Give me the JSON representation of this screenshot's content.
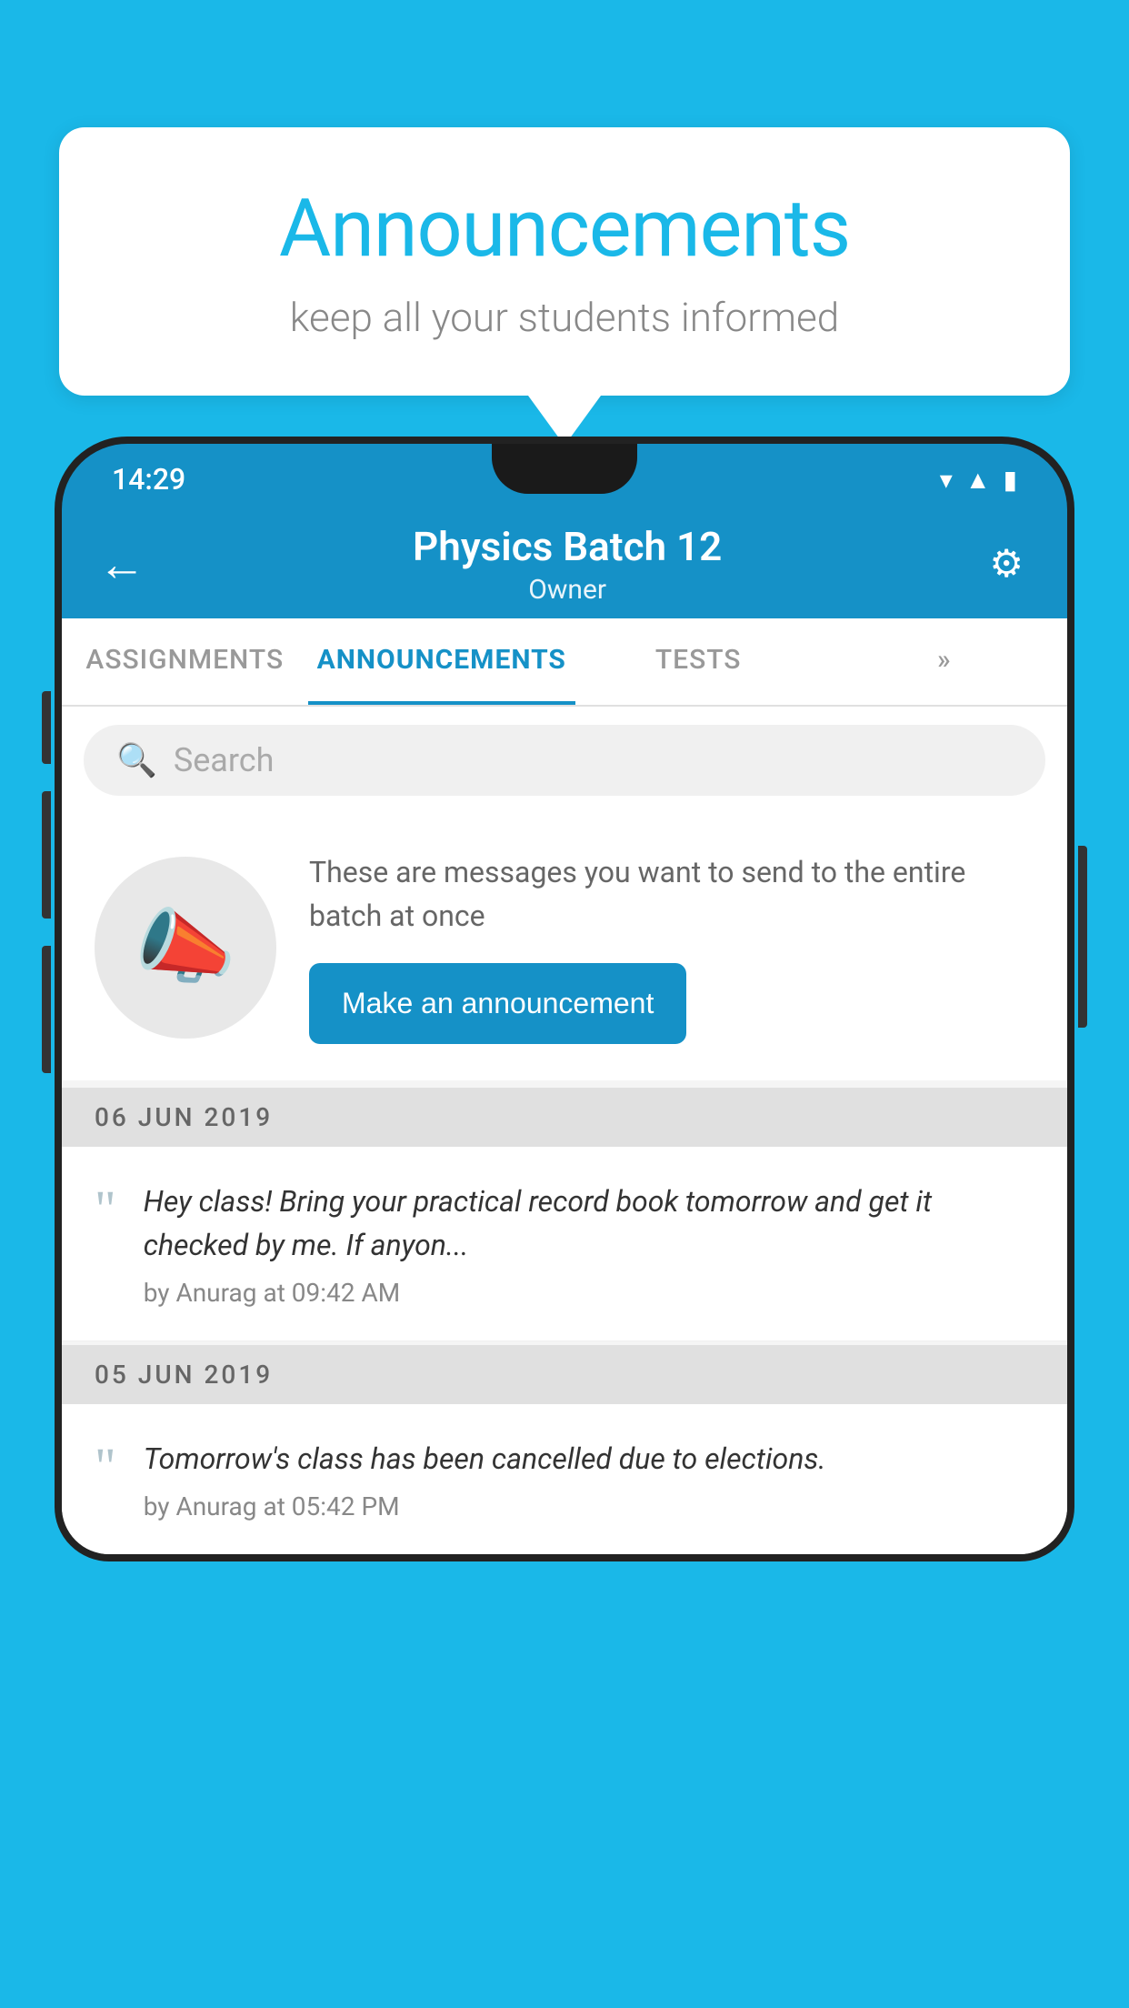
{
  "header": {
    "background_color": "#1ab8e8",
    "speech_bubble": {
      "title": "Announcements",
      "subtitle": "keep all your students informed"
    }
  },
  "phone": {
    "status_bar": {
      "time": "14:29",
      "wifi": "▾",
      "signal": "▲",
      "battery": "▮"
    },
    "app_header": {
      "back_label": "←",
      "title": "Physics Batch 12",
      "subtitle": "Owner",
      "settings_icon": "⚙"
    },
    "tabs": [
      {
        "label": "ASSIGNMENTS",
        "active": false
      },
      {
        "label": "ANNOUNCEMENTS",
        "active": true
      },
      {
        "label": "TESTS",
        "active": false
      },
      {
        "label": "»",
        "active": false
      }
    ],
    "search": {
      "placeholder": "Search"
    },
    "announcement_prompt": {
      "description": "These are messages you want to send to the entire batch at once",
      "button_label": "Make an announcement"
    },
    "announcements": [
      {
        "date": "06  JUN  2019",
        "text": "Hey class! Bring your practical record book tomorrow and get it checked by me. If anyon...",
        "meta": "by Anurag at 09:42 AM"
      },
      {
        "date": "05  JUN  2019",
        "text": "Tomorrow's class has been cancelled due to elections.",
        "meta": "by Anurag at 05:42 PM"
      }
    ]
  }
}
